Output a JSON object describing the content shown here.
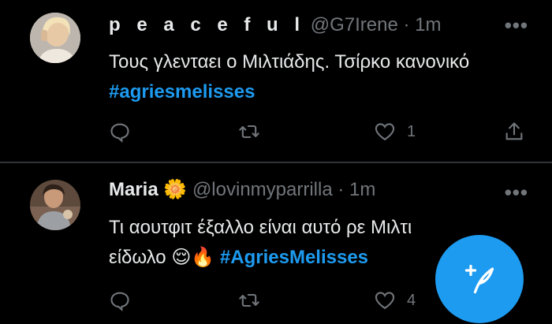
{
  "tweets": [
    {
      "display_name": "peaceful",
      "display_name_spaced": "p e a c e f u l",
      "handle": "@G7Irene",
      "separator": "·",
      "time": "1m",
      "text": "Τους γλενταει ο Μιλτιάδης. Τσίρκο κανονικό",
      "hashtag": "#agriesmelisses",
      "reply_count": "",
      "retweet_count": "",
      "like_count": "1"
    },
    {
      "display_name": "Maria",
      "name_emoji": "🌼",
      "handle": "@lovinmyparrilla",
      "separator": "·",
      "time": "1m",
      "text_line1": "Τι αουτφιτ έξαλλο είναι αυτό ρε Μιλτι",
      "text_line2": "είδωλο",
      "emojis": "😌🔥",
      "hashtag": "#AgriesMelisses",
      "like_count": "4"
    }
  ],
  "colors": {
    "background": "#000000",
    "text": "#e7e9ea",
    "muted": "#71767b",
    "accent": "#1d9bf0",
    "divider": "#2f3336"
  },
  "icons": [
    "reply-icon",
    "retweet-icon",
    "like-icon",
    "share-icon",
    "more-icon",
    "compose-icon"
  ]
}
